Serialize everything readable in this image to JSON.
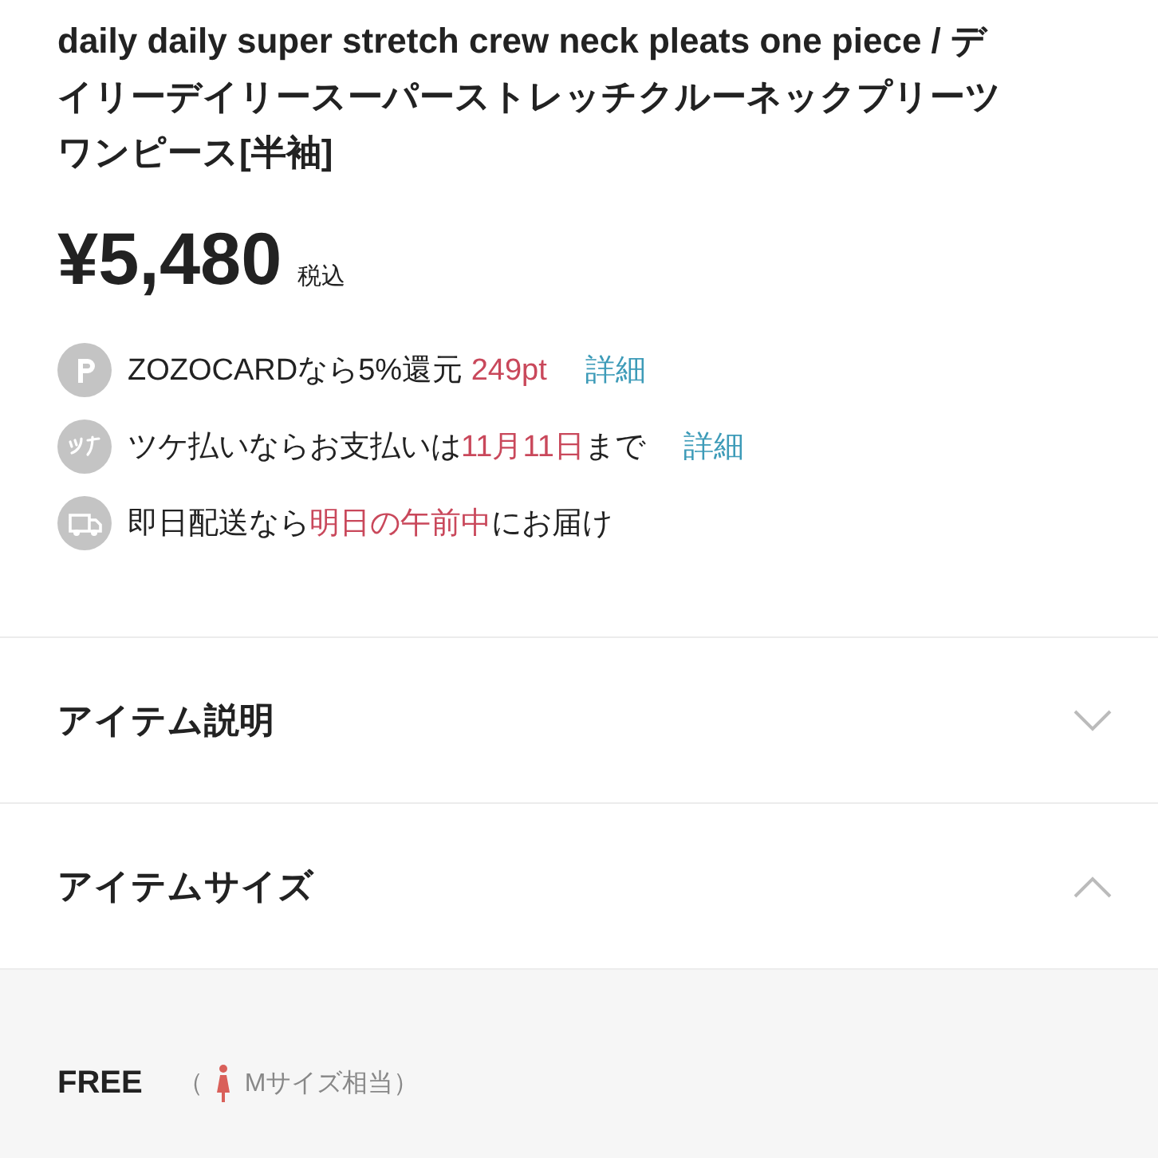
{
  "title": "daily daily super stretch crew neck pleats one piece / デイリーデイリースーパーストレッチクルーネックプリーツワンピース[半袖]",
  "price": {
    "amount": "¥5,480",
    "tax": "税込"
  },
  "benefits": [
    {
      "kind": "points",
      "segments": [
        {
          "text": "ZOZOCARDなら5%還元 ",
          "emphasis": false
        },
        {
          "text": "249pt",
          "emphasis": true
        }
      ],
      "link": "詳細"
    },
    {
      "kind": "tsuke",
      "segments": [
        {
          "text": "ツケ払いならお支払いは",
          "emphasis": false
        },
        {
          "text": "11月11日",
          "emphasis": true
        },
        {
          "text": "まで",
          "emphasis": false
        }
      ],
      "link": "詳細"
    },
    {
      "kind": "delivery",
      "segments": [
        {
          "text": "即日配送なら",
          "emphasis": false
        },
        {
          "text": "明日の午前中",
          "emphasis": true
        },
        {
          "text": "にお届け",
          "emphasis": false
        }
      ]
    }
  ],
  "sections": [
    {
      "label": "アイテム説明",
      "expanded": false
    },
    {
      "label": "アイテムサイズ",
      "expanded": true
    }
  ],
  "size": {
    "name": "FREE",
    "open_paren": "（",
    "equivalent": "Mサイズ相当）"
  }
}
